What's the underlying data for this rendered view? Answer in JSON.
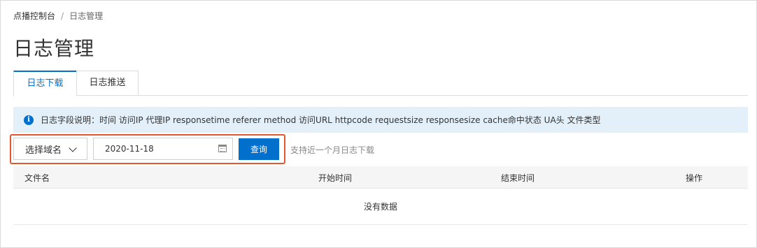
{
  "breadcrumb": {
    "root": "点播控制台",
    "separator": "/",
    "current": "日志管理"
  },
  "page_title": "日志管理",
  "tabs": [
    {
      "label": "日志下载",
      "active": true
    },
    {
      "label": "日志推送",
      "active": false
    }
  ],
  "info_banner": {
    "icon": "info-icon",
    "text": "日志字段说明：时间 访问IP 代理IP responsetime referer method 访问URL httpcode requestsize responsesize cache命中状态 UA头 文件类型"
  },
  "filters": {
    "domain_select": {
      "value": "选择域名",
      "icon": "chevron-down-icon"
    },
    "date": {
      "value": "2020-11-18",
      "icon": "calendar-icon"
    },
    "query_button": "查询",
    "hint": "支持近一个月日志下载"
  },
  "table": {
    "columns": [
      "文件名",
      "开始时间",
      "结束时间",
      "操作"
    ],
    "empty_text": "没有数据"
  },
  "colors": {
    "accent": "#0070cc",
    "highlight": "#e5562f",
    "info_bg": "#e3f0fa"
  }
}
